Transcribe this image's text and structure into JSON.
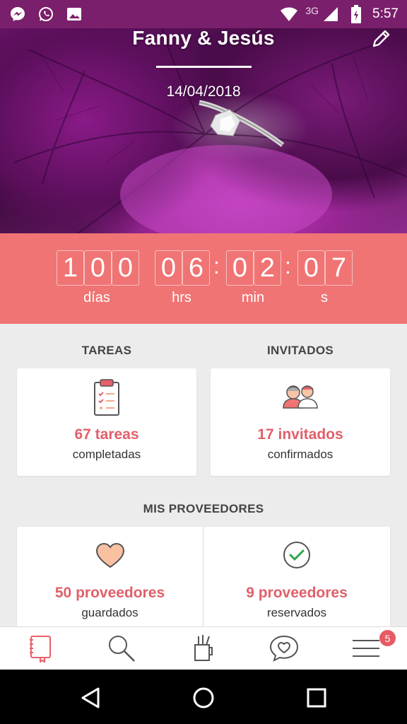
{
  "status_bar": {
    "network": "3G",
    "time": "5:57",
    "icons": [
      "messenger-icon",
      "whatsapp-icon",
      "image-icon",
      "wifi-icon",
      "signal-icon",
      "battery-icon"
    ]
  },
  "header": {
    "couple": "Fanny & Jesús",
    "date": "14/04/2018",
    "edit_icon": "pencil-icon"
  },
  "countdown": {
    "days": [
      "1",
      "0",
      "0"
    ],
    "hours": [
      "0",
      "6"
    ],
    "minutes": [
      "0",
      "2"
    ],
    "seconds": [
      "0",
      "7"
    ],
    "labels": {
      "days": "días",
      "hours": "hrs",
      "minutes": "min",
      "seconds": "s"
    },
    "colon": ":"
  },
  "tasks": {
    "heading": "TAREAS",
    "count": "67 tareas",
    "status": "completadas",
    "icon": "clipboard-checklist-icon"
  },
  "guests": {
    "heading": "INVITADOS",
    "count": "17 invitados",
    "status": "confirmados",
    "icon": "guests-couple-icon"
  },
  "vendors": {
    "heading": "MIS PROVEEDORES",
    "saved": {
      "count": "50 proveedores",
      "status": "guardados",
      "icon": "heart-icon"
    },
    "booked": {
      "count": "9 proveedores",
      "status": "reservados",
      "icon": "check-circle-icon"
    }
  },
  "bottom_nav": {
    "items": [
      "notebook-icon",
      "search-icon",
      "vendors-tools-icon",
      "chat-heart-icon",
      "menu-icon"
    ],
    "badge": "5"
  },
  "colors": {
    "accent": "#f07474",
    "count_text": "#e0606a",
    "badge": "#e65a64",
    "background": "#ececec"
  }
}
